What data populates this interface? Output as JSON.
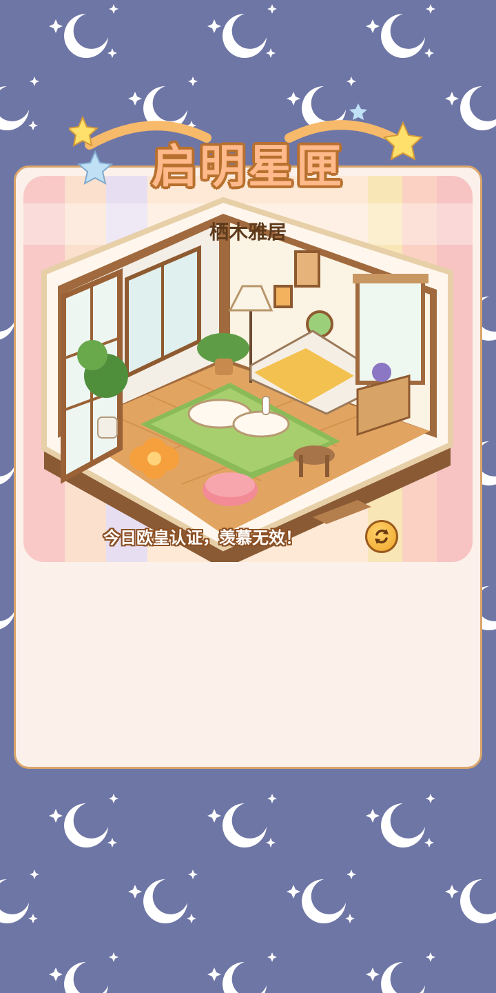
{
  "title": "启明星匣",
  "room": {
    "name": "栖木雅居"
  },
  "caption": "今日欧皇认证，羡慕无效！",
  "icons": {
    "refresh": "refresh-icon"
  },
  "colors": {
    "background": "#6e76a6",
    "panel": "#fbf1ea",
    "panel_border": "#d9a56a",
    "title_fill": "#ffb98a",
    "title_outline": "#b8702e"
  }
}
